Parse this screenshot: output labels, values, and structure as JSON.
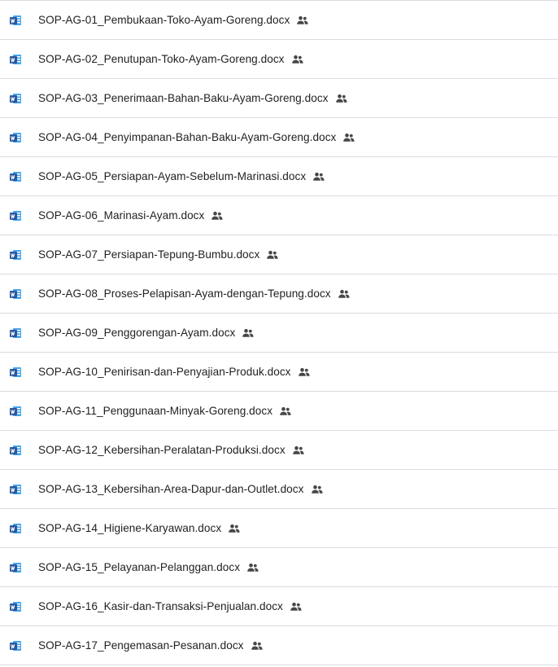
{
  "colors": {
    "word_blue": "#2b579a",
    "word_light": "#41a5ee",
    "divider": "#dadce0",
    "text": "#1f1f1f",
    "shared_icon": "#444746"
  },
  "files": [
    {
      "name": "SOP-AG-01_Pembukaan-Toko-Ayam-Goreng.docx",
      "icon": "word-doc-icon",
      "shared": true
    },
    {
      "name": "SOP-AG-02_Penutupan-Toko-Ayam-Goreng.docx",
      "icon": "word-doc-icon",
      "shared": true
    },
    {
      "name": "SOP-AG-03_Penerimaan-Bahan-Baku-Ayam-Goreng.docx",
      "icon": "word-doc-icon",
      "shared": true
    },
    {
      "name": "SOP-AG-04_Penyimpanan-Bahan-Baku-Ayam-Goreng.docx",
      "icon": "word-doc-icon",
      "shared": true
    },
    {
      "name": "SOP-AG-05_Persiapan-Ayam-Sebelum-Marinasi.docx",
      "icon": "word-doc-icon",
      "shared": true
    },
    {
      "name": "SOP-AG-06_Marinasi-Ayam.docx",
      "icon": "word-doc-icon",
      "shared": true
    },
    {
      "name": "SOP-AG-07_Persiapan-Tepung-Bumbu.docx",
      "icon": "word-doc-icon",
      "shared": true
    },
    {
      "name": "SOP-AG-08_Proses-Pelapisan-Ayam-dengan-Tepung.docx",
      "icon": "word-doc-icon",
      "shared": true
    },
    {
      "name": "SOP-AG-09_Penggorengan-Ayam.docx",
      "icon": "word-doc-icon",
      "shared": true
    },
    {
      "name": "SOP-AG-10_Penirisan-dan-Penyajian-Produk.docx",
      "icon": "word-doc-icon",
      "shared": true
    },
    {
      "name": "SOP-AG-11_Penggunaan-Minyak-Goreng.docx",
      "icon": "word-doc-icon",
      "shared": true
    },
    {
      "name": "SOP-AG-12_Kebersihan-Peralatan-Produksi.docx",
      "icon": "word-doc-icon",
      "shared": true
    },
    {
      "name": "SOP-AG-13_Kebersihan-Area-Dapur-dan-Outlet.docx",
      "icon": "word-doc-icon",
      "shared": true
    },
    {
      "name": "SOP-AG-14_Higiene-Karyawan.docx",
      "icon": "word-doc-icon",
      "shared": true
    },
    {
      "name": "SOP-AG-15_Pelayanan-Pelanggan.docx",
      "icon": "word-doc-icon",
      "shared": true
    },
    {
      "name": "SOP-AG-16_Kasir-dan-Transaksi-Penjualan.docx",
      "icon": "word-doc-icon",
      "shared": true
    },
    {
      "name": "SOP-AG-17_Pengemasan-Pesanan.docx",
      "icon": "word-doc-icon",
      "shared": true
    }
  ]
}
